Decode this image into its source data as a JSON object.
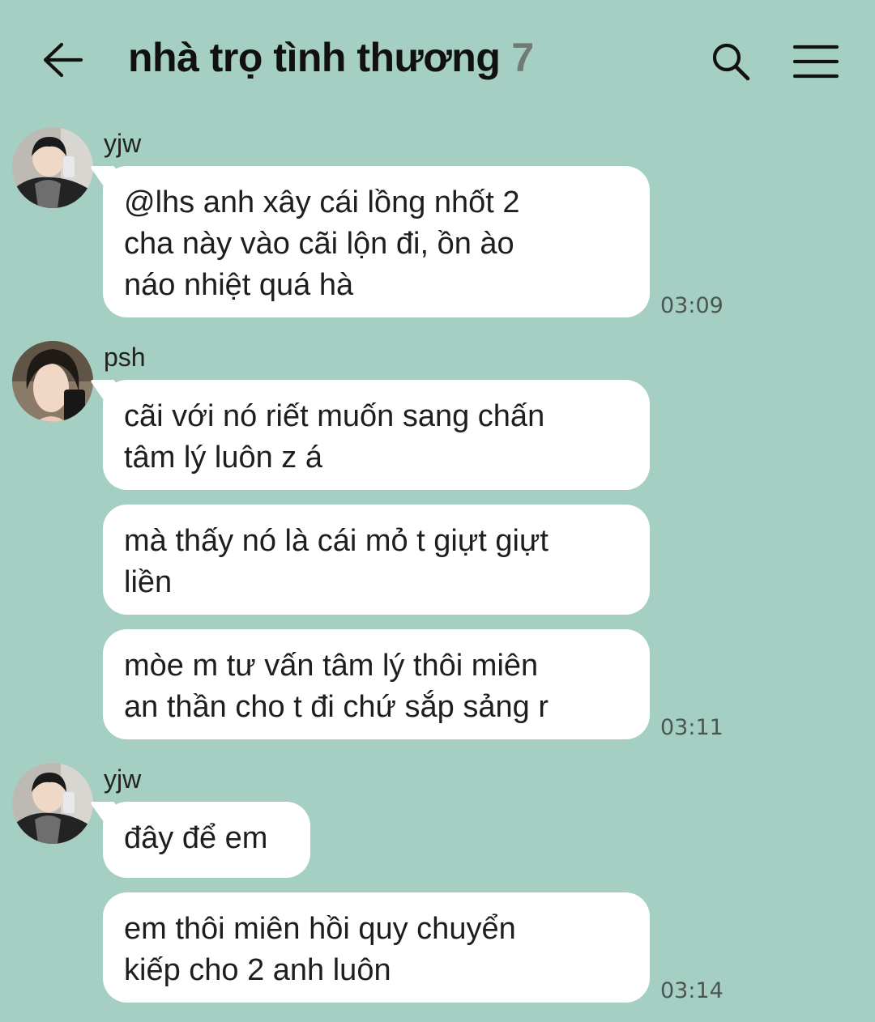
{
  "header": {
    "title": "nhà trọ tình thương",
    "member_count": "7"
  },
  "groups": [
    {
      "sender": "yjw",
      "messages": [
        "@lhs anh xây cái lồng nhốt 2\ncha này vào cãi lộn đi, ồn ào\nnáo nhiệt quá hà"
      ],
      "time": "03:09"
    },
    {
      "sender": "psh",
      "messages": [
        "cãi với nó riết muốn sang chấn\ntâm lý luôn z á",
        "mà thấy nó là cái mỏ t giựt giựt\nliền",
        "mòe m tư vấn tâm lý thôi miên\nan thần cho t đi chứ sắp sảng r"
      ],
      "time": "03:11"
    },
    {
      "sender": "yjw",
      "messages": [
        "đây để em",
        "em thôi miên hồi quy chuyển\nkiếp cho 2 anh luôn"
      ],
      "time": "03:14"
    }
  ],
  "icons": {
    "back": "arrow-left-icon",
    "search": "search-icon",
    "menu": "hamburger-menu-icon"
  },
  "colors": {
    "background": "#a5cfc2",
    "bubble": "#ffffff",
    "count": "#707a77"
  }
}
